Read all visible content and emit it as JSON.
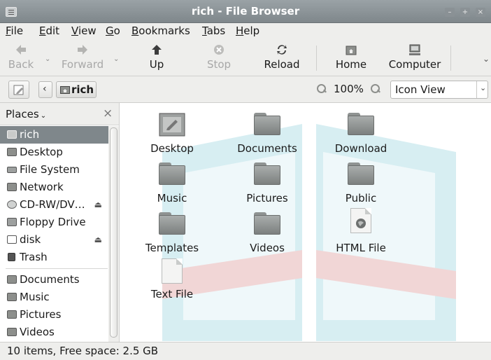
{
  "window": {
    "title": "rich - File Browser"
  },
  "menubar": {
    "items": [
      "File",
      "Edit",
      "View",
      "Go",
      "Bookmarks",
      "Tabs",
      "Help"
    ]
  },
  "toolbar": {
    "back": "Back",
    "forward": "Forward",
    "up": "Up",
    "stop": "Stop",
    "reload": "Reload",
    "home": "Home",
    "computer": "Computer"
  },
  "location": {
    "path_button": "rich",
    "zoom": "100%",
    "view_mode": "Icon View"
  },
  "sidebar": {
    "header": "Places",
    "items": [
      {
        "label": "rich",
        "icon": "home-folder-icon",
        "selected": true
      },
      {
        "label": "Desktop",
        "icon": "desktop-icon"
      },
      {
        "label": "File System",
        "icon": "harddisk-icon"
      },
      {
        "label": "Network",
        "icon": "network-icon"
      },
      {
        "label": "CD-RW/DV…",
        "icon": "optical-drive-icon",
        "eject": true
      },
      {
        "label": "Floppy Drive",
        "icon": "floppy-icon"
      },
      {
        "label": "disk",
        "icon": "removable-disk-icon",
        "eject": true
      },
      {
        "label": "Trash",
        "icon": "trash-icon"
      }
    ],
    "bookmarks": [
      {
        "label": "Documents",
        "icon": "folder-icon"
      },
      {
        "label": "Music",
        "icon": "folder-icon"
      },
      {
        "label": "Pictures",
        "icon": "folder-icon"
      },
      {
        "label": "Videos",
        "icon": "folder-icon"
      }
    ]
  },
  "content": {
    "items": [
      {
        "label": "Desktop",
        "type": "desktop"
      },
      {
        "label": "Documents",
        "type": "folder"
      },
      {
        "label": "Download",
        "type": "folder"
      },
      {
        "label": "Music",
        "type": "folder"
      },
      {
        "label": "Pictures",
        "type": "folder"
      },
      {
        "label": "Public",
        "type": "folder"
      },
      {
        "label": "Templates",
        "type": "folder"
      },
      {
        "label": "Videos",
        "type": "folder"
      },
      {
        "label": "HTML File",
        "type": "html"
      },
      {
        "label": "Text File",
        "type": "text"
      }
    ]
  },
  "status": {
    "text": "10 items, Free space: 2.5 GB"
  },
  "colors": {
    "selection": "#7f878b",
    "panel": "#eeeeec",
    "watermark": "#8fd0dc"
  }
}
